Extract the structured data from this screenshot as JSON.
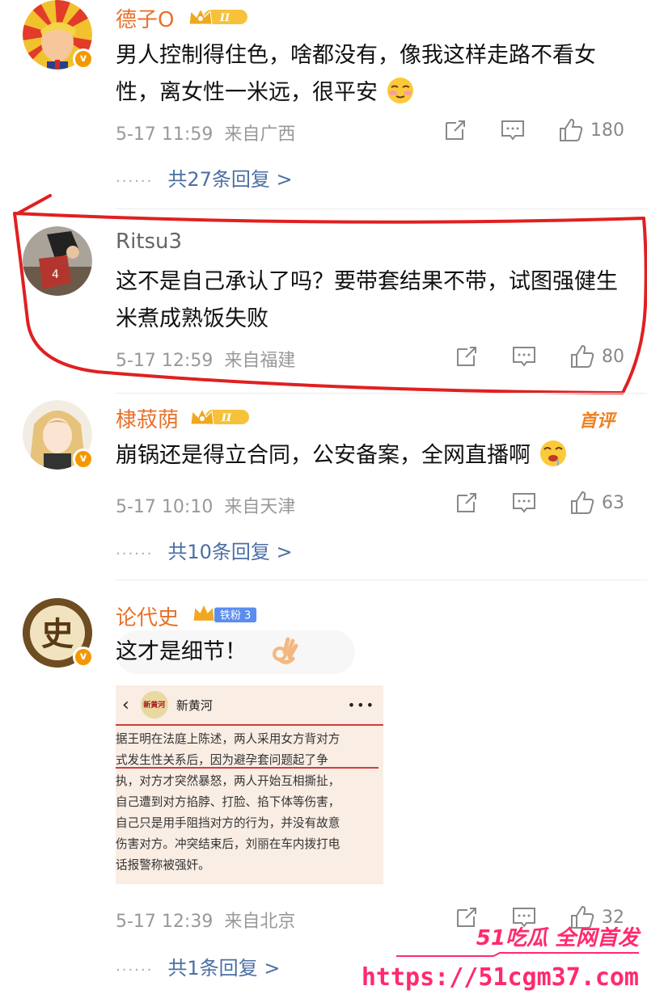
{
  "comments": [
    {
      "username": "德子O",
      "level": "II",
      "text": "男人控制得住色，啥都没有，像我这样走路不看女性，离女性一米远，很平安",
      "emoji": "smirk-emoji",
      "date": "5-17 11:59",
      "location": "来自广西",
      "likes": "180",
      "replies": "共27条回复 >"
    },
    {
      "username": "Ritsu3",
      "text": "这不是自己承认了吗？要带套结果不带，试图强健生米煮成熟饭失败",
      "date": "5-17 12:59",
      "location": "来自福建",
      "likes": "80"
    },
    {
      "username": "棣菽荫",
      "level": "II",
      "hot_label": "首评",
      "text": "崩锅还是得立合同，公安备案，全网直播啊",
      "emoji": "drool-emoji",
      "date": "5-17 10:10",
      "location": "来自天津",
      "likes": "63",
      "replies": "共10条回复 >"
    },
    {
      "username": "论代史",
      "fan_badge": "铁粉 3",
      "avatar_char": "史",
      "text": "这才是细节！",
      "emoji": "ok-hand-emoji",
      "date": "5-17 12:39",
      "location": "来自北京",
      "likes": "32",
      "replies": "共1条回复 >"
    }
  ],
  "image_card": {
    "source": "新黄河",
    "logo_text": "新黄河",
    "more": "•••",
    "lines": [
      "据王明在法庭上陈述，两人采用女方背对方",
      "式发生性关系后，因为避孕套问题起了争",
      "执，对方才突然暴怒，两人开始互相撕扯，",
      "自己遭到对方掐脖、打脸、掐下体等伤害，",
      "自己只是用手阻挡对方的行为，并没有故意",
      "伤害对方。冲突结束后，刘丽在车内拨打电",
      "话报警称被强奸。"
    ]
  },
  "watermark": {
    "brand": "51吃瓜 全网首发",
    "url": "https://51cgm37.com"
  },
  "colors": {
    "username": "#e8712a",
    "reply_link": "#4a6fa5",
    "meta": "#999999",
    "annotation_red": "#e02020",
    "watermark_pink": "#ff2a6d"
  }
}
